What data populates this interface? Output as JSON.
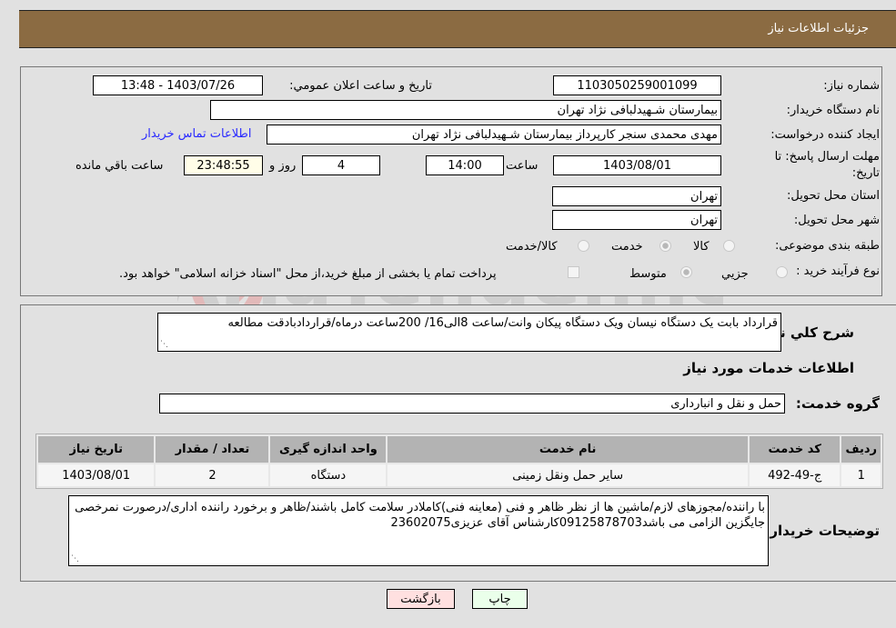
{
  "header": {
    "title": "جزئیات اطلاعات نیاز"
  },
  "form": {
    "need_number": {
      "label": "شماره نیاز:",
      "value": "1103050259001099"
    },
    "announce_datetime": {
      "label": "تاریخ و ساعت اعلان عمومي:",
      "value": "1403/07/26 - 13:48"
    },
    "buyer_org": {
      "label": "نام دستگاه خریدار:",
      "value": "بیمارستان شـهیدلبافی نژاد تهران"
    },
    "requester": {
      "label": "ایجاد کننده درخواست:",
      "value": "مهدی محمدی سنجر کارپرداز بیمارستان شـهیدلبافی نژاد تهران",
      "contact_link": "اطلاعات تماس خریدار"
    },
    "deadline": {
      "label_line1": "مهلت ارسال پاسخ: تا",
      "label_line2": "تاریخ:",
      "date": "1403/08/01",
      "time_label": "ساعت",
      "time": "14:00",
      "days": "4",
      "days_label": "روز و",
      "remaining": "23:48:55",
      "remaining_label": "ساعت باقي مانده"
    },
    "province": {
      "label": "استان محل تحویل:",
      "value": "تهران"
    },
    "city": {
      "label": "شهر محل تحویل:",
      "value": "تهران"
    },
    "category": {
      "label": "طبقه بندی موضوعی:",
      "options": [
        {
          "label": "کالا",
          "checked": false
        },
        {
          "label": "خدمت",
          "checked": true
        },
        {
          "label": "کالا/خدمت",
          "checked": false
        }
      ]
    },
    "purchase_type": {
      "label": "نوع فرآیند خرید :",
      "options": [
        {
          "label": "جزيي",
          "checked": false
        },
        {
          "label": "متوسط",
          "checked": true
        }
      ],
      "treasury_checkbox_label": "پرداخت تمام یا بخشی از مبلغ خرید،از محل \"اسناد خزانه اسلامی\" خواهد بود."
    }
  },
  "description": {
    "label": "شرح کلي نیاز:",
    "value": "قرارداد بابت یک دستگاه نیسان ویک دستگاه پیکان وانت/ساعت 8الی16/ 200ساعت درماه/قراردادبادقت مطالعه"
  },
  "services": {
    "section_title": "اطلاعات خدمات مورد نیاز",
    "group_label": "گروه خدمت:",
    "group_value": "حمل و نقل و انبارداری",
    "table": {
      "headers": [
        "ردیف",
        "کد خدمت",
        "نام خدمت",
        "واحد اندازه گیری",
        "تعداد / مقدار",
        "تاریخ نیاز"
      ],
      "rows": [
        [
          "1",
          "ج-49-492",
          "سایر حمل ونقل زمینی",
          "دستگاه",
          "2",
          "1403/08/01"
        ]
      ]
    }
  },
  "buyer_notes": {
    "label": "توضیحات خریدار:",
    "value": "با راننده/مجوزهای لازم/ماشین ها از نظر ظاهر و فنی (معاینه فنی)کاملادر سلامت کامل باشند/ظاهر و برخورد راننده اداری/درصورت نمرخصی جایگزین الزامی می باشد09125878703کارشناس آقای عزیزی23602075"
  },
  "buttons": {
    "print": "چاپ",
    "back": "بازگشت"
  },
  "colors": {
    "header_bg": "#8b6b42",
    "print_bg": "#eaffea",
    "back_bg": "#ffe0e0",
    "link": "#2a2aff"
  },
  "watermark": {
    "text": "AriaTender.net"
  }
}
